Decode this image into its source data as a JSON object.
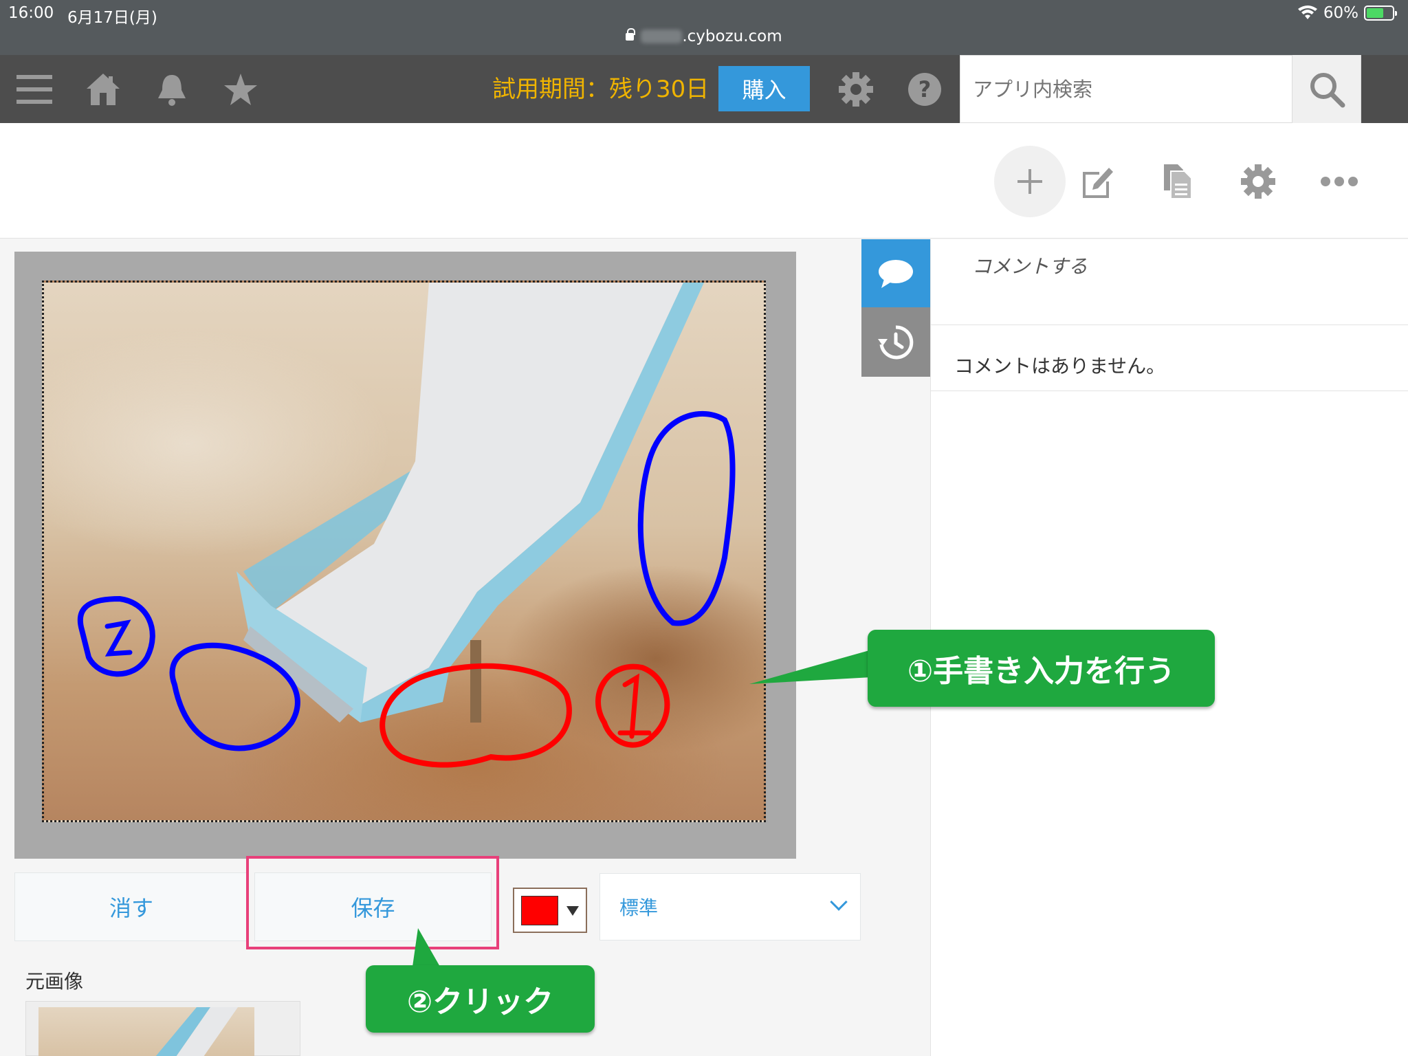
{
  "status_bar": {
    "time": "16:00",
    "date": "6月17日(月)",
    "url_suffix": ".cybozu.com",
    "battery": "60%"
  },
  "header": {
    "trial_text": "試用期間：残り30日",
    "buy_label": "購入",
    "search_placeholder": "アプリ内検索"
  },
  "icons": {
    "menu": "menu-icon",
    "home": "home-icon",
    "notifications": "bell-icon",
    "favorites": "star-icon",
    "settings": "gear-icon",
    "help": "help-icon",
    "search": "search-icon",
    "add": "plus-icon",
    "edit": "edit-icon",
    "duplicate": "copy-icon",
    "record_settings": "gear-icon",
    "more": "more-icon",
    "comments_tab": "comment-icon",
    "history_tab": "history-icon"
  },
  "editor": {
    "erase_label": "消す",
    "save_label": "保存",
    "pen_color": "#ff0000",
    "pen_width_selected": "標準",
    "original_image_label": "元画像"
  },
  "comments": {
    "input_placeholder": "コメントする",
    "empty_message": "コメントはありません。"
  },
  "annotations": {
    "step1": "①手書き入力を行う",
    "step2": "②クリック",
    "callout_color": "#1fa83f",
    "highlight_color": "#e8407a"
  }
}
